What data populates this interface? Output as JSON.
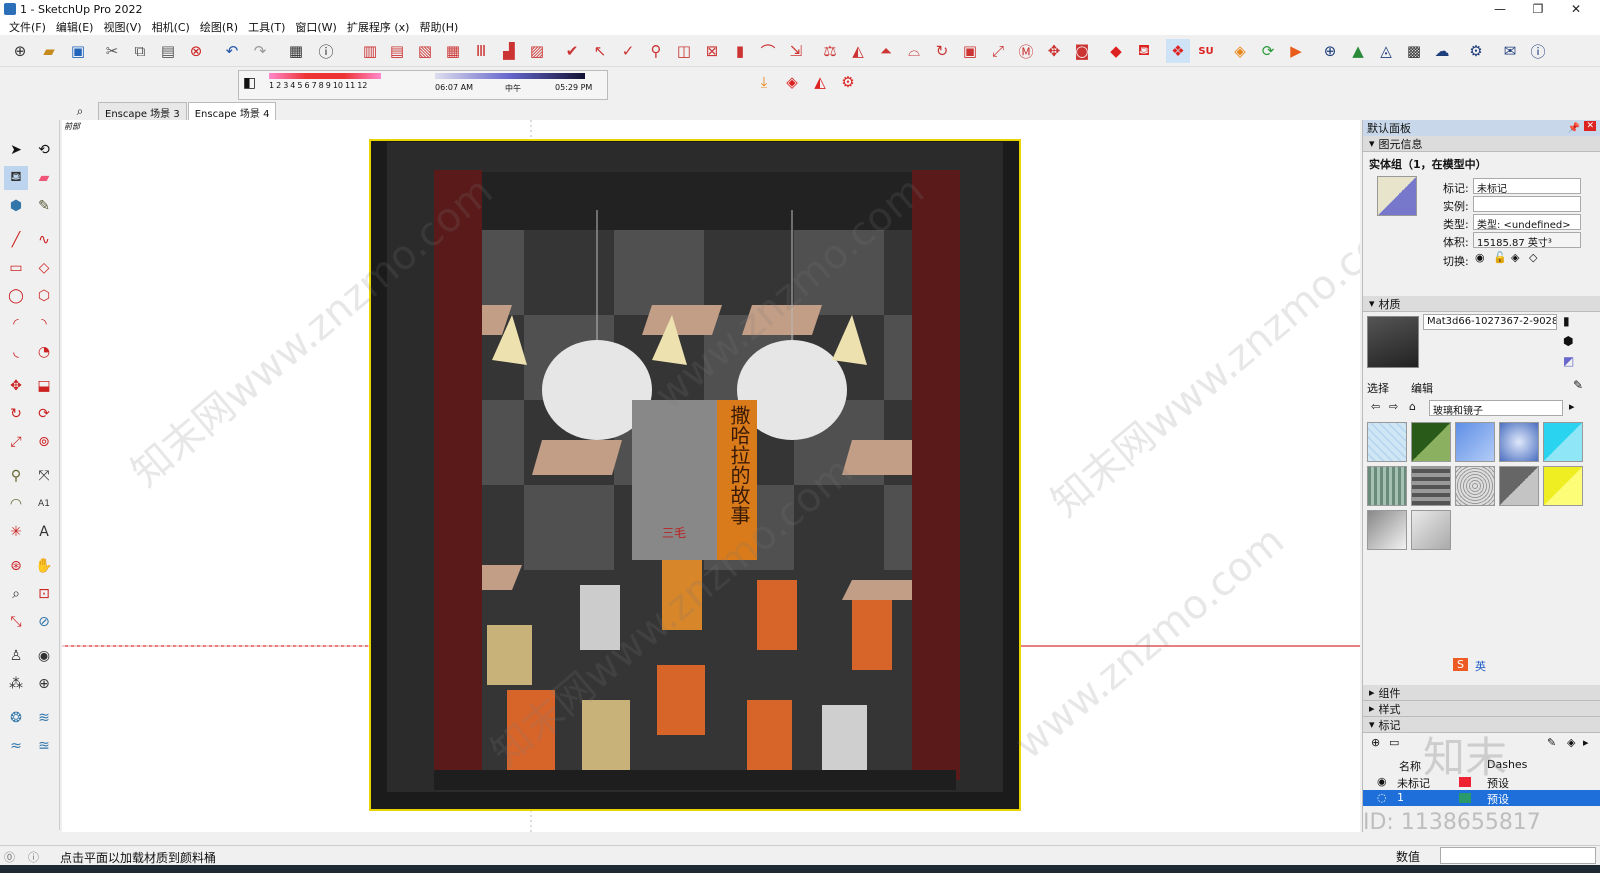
{
  "window": {
    "title": "1 - SketchUp Pro 2022"
  },
  "menu": [
    "文件(F)",
    "编辑(E)",
    "视图(V)",
    "相机(C)",
    "绘图(R)",
    "工具(T)",
    "窗口(W)",
    "扩展程序 (x)",
    "帮助(H)"
  ],
  "toolbar": {
    "shadow": {
      "months": [
        "1",
        "2",
        "3",
        "4",
        "5",
        "6",
        "7",
        "8",
        "9",
        "10",
        "11",
        "12"
      ],
      "time_start": "06:07 AM",
      "time_mid": "中午",
      "time_end": "05:29 PM"
    }
  },
  "scene_tabs": [
    "Enscape 场景 3",
    "Enscape 场景 4"
  ],
  "viewport": {
    "view_label": "前部",
    "poster": {
      "title": "撒哈拉的故事",
      "author": "三毛"
    },
    "watermarks": [
      "知末网www.znzmo.com",
      "www.znzmo.com",
      "知末网www.znzmo.com",
      "知末网www.znzmo.com",
      "www.znzmo.com"
    ]
  },
  "panel": {
    "title": "默认面板",
    "entity_info": {
      "header": "图元信息",
      "summary": "实体组（1，在模型中）",
      "tag_label": "标记:",
      "tag_value": "未标记",
      "instance_label": "实例:",
      "instance_value": "",
      "type_label": "类型:",
      "type_value": "类型: <undefined>",
      "volume_label": "体积:",
      "volume_value": "15185.87 英寸³",
      "toggle_label": "切换:"
    },
    "materials": {
      "header": "材质",
      "name": "Mat3d66-1027367-2-9028",
      "tab_select": "选择",
      "tab_edit": "编辑",
      "library": "玻璃和镜子"
    },
    "collapsed": [
      "组件",
      "样式"
    ],
    "tags": {
      "header": "标记",
      "col_name": "名称",
      "col_dashes": "Dashes",
      "rows": [
        {
          "name": "未标记",
          "dash": "预设"
        },
        {
          "name": "1",
          "dash": "预设"
        }
      ]
    },
    "ime": "英",
    "watermark_id": "ID: 1138655817",
    "watermark_logo": "知末"
  },
  "status": {
    "hint": "点击平面以加载材质到颜料桶",
    "measure_label": "数值"
  },
  "colors": {
    "accent": "#3a7bd5",
    "selection": "#1e6fd9",
    "axis_red": "#cc0000"
  }
}
